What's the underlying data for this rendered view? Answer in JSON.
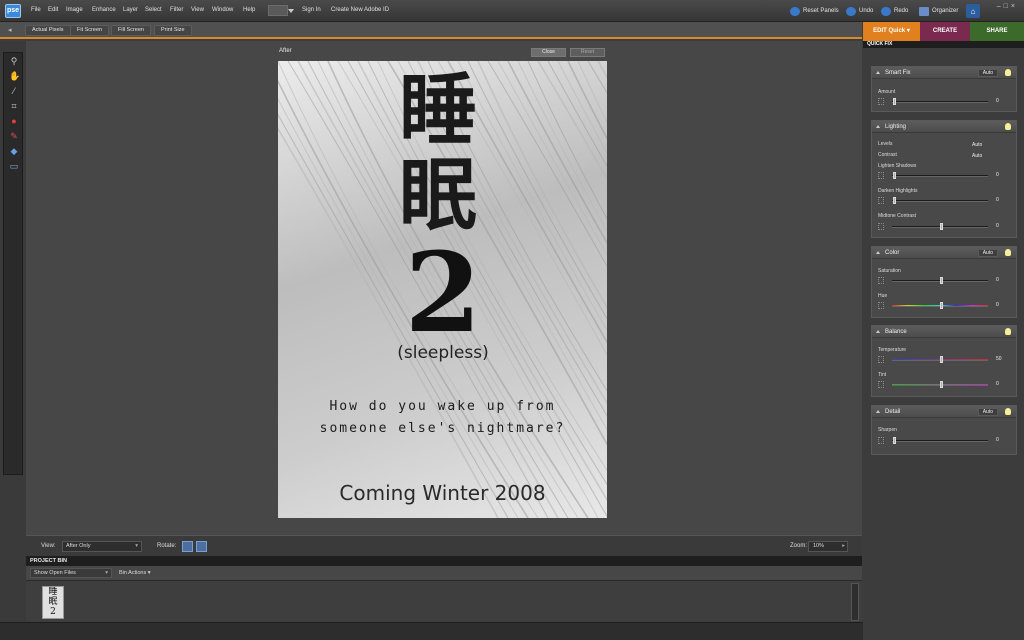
{
  "app": {
    "logo": "pse"
  },
  "menu": [
    "File",
    "Edit",
    "Image",
    "Enhance",
    "Layer",
    "Select",
    "Filter",
    "View",
    "Window",
    "Help"
  ],
  "menu_extra": {
    "sign_in": "Sign In",
    "create_id": "Create New Adobe ID"
  },
  "toolbar_right": {
    "reset_panels": "Reset Panels",
    "undo": "Undo",
    "redo": "Redo",
    "organizer": "Organizer"
  },
  "options": {
    "actual_pixels": "Actual Pixels",
    "fit_screen": "Fit Screen",
    "fill_screen": "Fill Screen",
    "print_size": "Print Size"
  },
  "mode_tabs": {
    "edit": "EDIT Quick",
    "create": "CREATE",
    "share": "SHARE",
    "edit_color": "#e0801e",
    "create_color": "#7a2a4e",
    "share_color": "#3c6a2a"
  },
  "panel_header": "QUICK FIX",
  "canvas": {
    "view_label": "After",
    "close": "Close",
    "reset": "Reset"
  },
  "poster": {
    "kanji_line1": "睡",
    "kanji_line2": "眠",
    "number": "2",
    "subtitle": "(sleepless)",
    "tagline1": "How do you wake up from",
    "tagline2": "someone else's nightmare?",
    "release": "Coming Winter 2008"
  },
  "viewbar": {
    "view_label": "View:",
    "view_value": "After Only",
    "rotate_label": "Rotate:",
    "zoom_label": "Zoom:",
    "zoom_value": "10%"
  },
  "bin": {
    "header": "PROJECT BIN",
    "select_value": "Show Open Files",
    "actions": "Bin Actions"
  },
  "panels": {
    "smart_fix": {
      "title": "Smart Fix",
      "auto": "Auto",
      "amount_label": "Amount",
      "amount_value": "0",
      "amount_level": 0
    },
    "lighting": {
      "title": "Lighting",
      "levels_label": "Levels",
      "levels_auto": "Auto",
      "contrast_label": "Contrast",
      "contrast_auto": "Auto",
      "lighten_label": "Lighten Shadows",
      "lighten_value": "0",
      "darken_label": "Darken Highlights",
      "darken_value": "0",
      "midtone_label": "Midtone Contrast",
      "midtone_value": "0"
    },
    "color": {
      "title": "Color",
      "auto": "Auto",
      "saturation_label": "Saturation",
      "saturation_value": "0",
      "hue_label": "Hue",
      "hue_value": "0"
    },
    "balance": {
      "title": "Balance",
      "temperature_label": "Temperature",
      "temperature_value": "50",
      "tint_label": "Tint",
      "tint_value": "0"
    },
    "detail": {
      "title": "Detail",
      "auto": "Auto",
      "sharpen_label": "Sharpen",
      "sharpen_value": "0"
    }
  }
}
